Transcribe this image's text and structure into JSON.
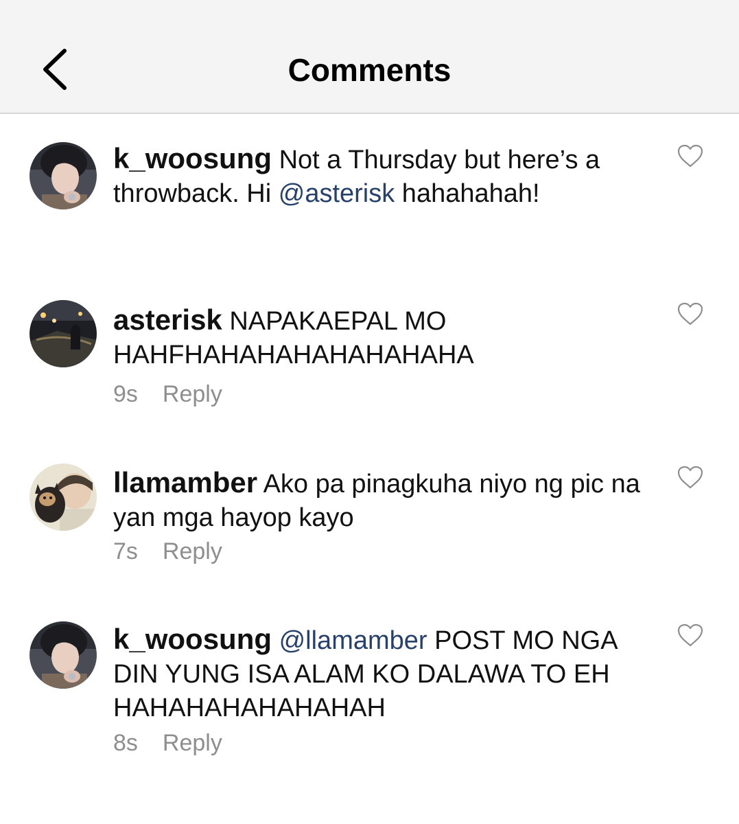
{
  "header": {
    "title": "Comments",
    "back_icon": "chevron-left-icon"
  },
  "comments": [
    {
      "username": "k_woosung",
      "text_before": " Not a Thursday but here’s a throwback. Hi ",
      "mention": "@asterisk",
      "text_after": " hahahahah!",
      "time": "",
      "reply_label": ""
    },
    {
      "username": "asterisk",
      "text_before": " NAPAKAEPAL MO HAHFHAHAHAHAHAHAHAHA",
      "mention": "",
      "text_after": "",
      "time": "9s",
      "reply_label": "Reply"
    },
    {
      "username": "llamamber",
      "text_before": " Ako pa pinagkuha niyo ng pic na yan mga hayop kayo",
      "mention": "",
      "text_after": "",
      "time": "7s",
      "reply_label": "Reply"
    },
    {
      "username": "k_woosung",
      "text_before": " ",
      "mention": "@llamamber",
      "text_after": " POST MO NGA DIN YUNG ISA ALAM KO DALAWA TO EH HAHAHAHAHAHAHAH",
      "time": "8s",
      "reply_label": "Reply"
    }
  ],
  "icons": {
    "like": "heart-outline-icon"
  },
  "colors": {
    "mention": "#27416b",
    "meta": "#8e8e8e",
    "header_bg": "#f4f4f4"
  }
}
